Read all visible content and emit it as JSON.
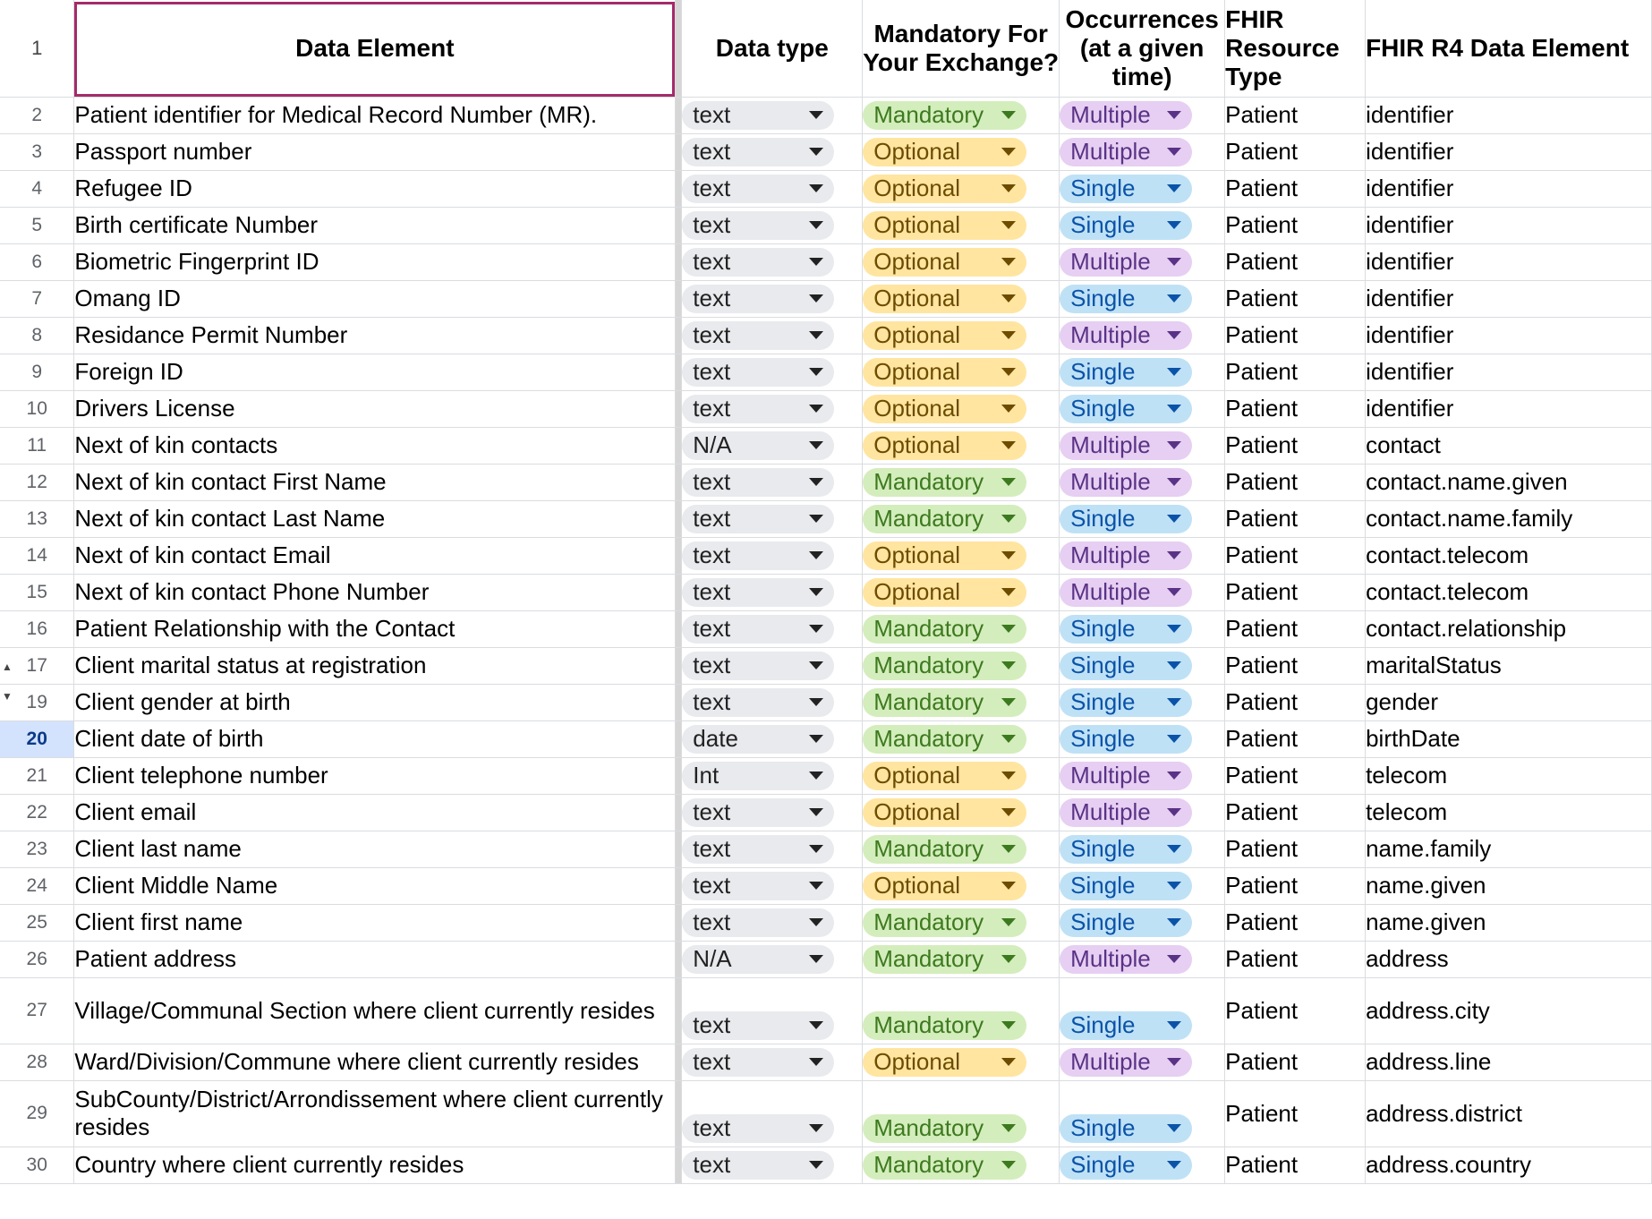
{
  "header": {
    "row_number": "1",
    "data_element": "Data Element",
    "data_type": "Data type",
    "mandatory": "Mandatory For Your Exchange?",
    "occurrences": "Occurrences (at a given time)",
    "resource_type": "FHIR Resource Type",
    "r4_element": "FHIR R4 Data Element"
  },
  "rows": [
    {
      "num": "2",
      "element": "Patient identifier for Medical Record Number (MR).",
      "dtype": "text",
      "mandatory": "Mandatory",
      "occ": "Multiple",
      "resource": "Patient",
      "r4": "identifier"
    },
    {
      "num": "3",
      "element": "Passport number",
      "dtype": "text",
      "mandatory": "Optional",
      "occ": "Multiple",
      "resource": "Patient",
      "r4": "identifier"
    },
    {
      "num": "4",
      "element": "Refugee ID",
      "dtype": "text",
      "mandatory": "Optional",
      "occ": "Single",
      "resource": "Patient",
      "r4": "identifier"
    },
    {
      "num": "5",
      "element": "Birth certificate Number",
      "dtype": "text",
      "mandatory": "Optional",
      "occ": "Single",
      "resource": "Patient",
      "r4": "identifier"
    },
    {
      "num": "6",
      "element": "Biometric Fingerprint ID",
      "dtype": "text",
      "mandatory": "Optional",
      "occ": "Multiple",
      "resource": "Patient",
      "r4": "identifier"
    },
    {
      "num": "7",
      "element": "Omang ID",
      "dtype": "text",
      "mandatory": "Optional",
      "occ": "Single",
      "resource": "Patient",
      "r4": "identifier"
    },
    {
      "num": "8",
      "element": "Residance Permit Number",
      "dtype": "text",
      "mandatory": "Optional",
      "occ": "Multiple",
      "resource": "Patient",
      "r4": "identifier"
    },
    {
      "num": "9",
      "element": "Foreign ID",
      "dtype": "text",
      "mandatory": "Optional",
      "occ": "Single",
      "resource": "Patient",
      "r4": "identifier"
    },
    {
      "num": "10",
      "element": "Drivers License",
      "dtype": "text",
      "mandatory": "Optional",
      "occ": "Single",
      "resource": "Patient",
      "r4": "identifier"
    },
    {
      "num": "11",
      "element": "Next of kin contacts",
      "dtype": "N/A",
      "mandatory": "Optional",
      "occ": "Multiple",
      "resource": "Patient",
      "r4": "contact"
    },
    {
      "num": "12",
      "element": "Next of kin contact First Name",
      "dtype": "text",
      "mandatory": "Mandatory",
      "occ": "Multiple",
      "resource": "Patient",
      "r4": "contact.name.given"
    },
    {
      "num": "13",
      "element": "Next of kin contact Last Name",
      "dtype": "text",
      "mandatory": "Mandatory",
      "occ": "Single",
      "resource": "Patient",
      "r4": "contact.name.family"
    },
    {
      "num": "14",
      "element": "Next of kin contact Email",
      "dtype": "text",
      "mandatory": "Optional",
      "occ": "Multiple",
      "resource": "Patient",
      "r4": "contact.telecom"
    },
    {
      "num": "15",
      "element": "Next of kin contact Phone Number",
      "dtype": "text",
      "mandatory": "Optional",
      "occ": "Multiple",
      "resource": "Patient",
      "r4": "contact.telecom"
    },
    {
      "num": "16",
      "element": "Patient Relationship with the Contact",
      "dtype": "text",
      "mandatory": "Mandatory",
      "occ": "Single",
      "resource": "Patient",
      "r4": "contact.relationship"
    },
    {
      "num": "17",
      "element": "Client marital status at registration",
      "dtype": "text",
      "mandatory": "Mandatory",
      "occ": "Single",
      "resource": "Patient",
      "r4": "maritalStatus",
      "marker": "up"
    },
    {
      "num": "19",
      "element": "Client gender at birth",
      "dtype": "text",
      "mandatory": "Mandatory",
      "occ": "Single",
      "resource": "Patient",
      "r4": "gender",
      "marker": "down"
    },
    {
      "num": "20",
      "element": "Client date of birth",
      "dtype": "date",
      "mandatory": "Mandatory",
      "occ": "Single",
      "resource": "Patient",
      "r4": "birthDate",
      "active": true
    },
    {
      "num": "21",
      "element": "Client telephone number",
      "dtype": "Int",
      "mandatory": "Optional",
      "occ": "Multiple",
      "resource": "Patient",
      "r4": "telecom"
    },
    {
      "num": "22",
      "element": "Client email",
      "dtype": "text",
      "mandatory": "Optional",
      "occ": "Multiple",
      "resource": "Patient",
      "r4": "telecom"
    },
    {
      "num": "23",
      "element": "Client last name",
      "dtype": "text",
      "mandatory": "Mandatory",
      "occ": "Single",
      "resource": "Patient",
      "r4": "name.family"
    },
    {
      "num": "24",
      "element": "Client Middle Name",
      "dtype": "text",
      "mandatory": "Optional",
      "occ": "Single",
      "resource": "Patient",
      "r4": "name.given"
    },
    {
      "num": "25",
      "element": "Client first name",
      "dtype": "text",
      "mandatory": "Mandatory",
      "occ": "Single",
      "resource": "Patient",
      "r4": "name.given"
    },
    {
      "num": "26",
      "element": "Patient address",
      "dtype": "N/A",
      "mandatory": "Mandatory",
      "occ": "Multiple",
      "resource": "Patient",
      "r4": "address"
    },
    {
      "num": "27",
      "element": "Village/Communal Section where client currently resides",
      "dtype": "text",
      "mandatory": "Mandatory",
      "occ": "Single",
      "resource": "Patient",
      "r4": "address.city",
      "tall": true
    },
    {
      "num": "28",
      "element": "Ward/Division/Commune where client currently resides",
      "dtype": "text",
      "mandatory": "Optional",
      "occ": "Multiple",
      "resource": "Patient",
      "r4": "address.line"
    },
    {
      "num": "29",
      "element": "SubCounty/District/Arrondissement where client currently resides",
      "dtype": "text",
      "mandatory": "Mandatory",
      "occ": "Single",
      "resource": "Patient",
      "r4": "address.district",
      "tall": true
    },
    {
      "num": "30",
      "element": "Country where client currently resides",
      "dtype": "text",
      "mandatory": "Mandatory",
      "occ": "Single",
      "resource": "Patient",
      "r4": "address.country"
    }
  ],
  "colors": {
    "mandatory_bg": "#d4edbc",
    "optional_bg": "#ffe5a0",
    "multiple_bg": "#e6cff2",
    "single_bg": "#bfe1f6",
    "selection_border": "#a52a6a",
    "active_row_bg": "#d3e3fd"
  }
}
